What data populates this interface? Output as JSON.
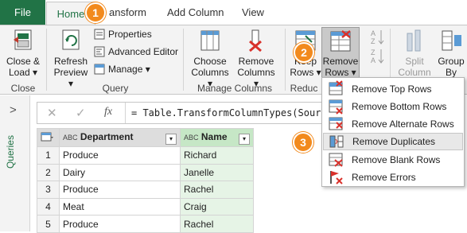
{
  "tabs": {
    "file": "File",
    "home": "Home",
    "transform": "ansform",
    "add_column": "Add Column",
    "view": "View"
  },
  "ribbon": {
    "close_load": [
      "Close &",
      "Load ▾"
    ],
    "close_group": "Close",
    "refresh_preview": [
      "Refresh",
      "Preview ▾"
    ],
    "properties": "Properties",
    "advanced_editor": "Advanced Editor",
    "manage": "Manage ▾",
    "query_group": "Query",
    "choose_columns": [
      "Choose",
      "Columns ▾"
    ],
    "remove_columns": [
      "Remove",
      "Columns ▾"
    ],
    "manage_columns_group": "Manage Columns",
    "keep_rows": [
      "Keep",
      "Rows ▾"
    ],
    "reduce_group": "Reduc",
    "remove_rows": [
      "Remove",
      "Rows ▾"
    ],
    "split_column": [
      "Split",
      "Column ▾"
    ],
    "group_by": [
      "Group",
      "By"
    ]
  },
  "left_pane": {
    "queries_label": "Queries",
    "collapse": ">"
  },
  "formula": {
    "cancel": "✕",
    "commit": "✓",
    "fx": "fx",
    "text": "= Table.TransformColumnTypes(Source,"
  },
  "table": {
    "columns": [
      {
        "type": "ABC",
        "name": "Department"
      },
      {
        "type": "ABC",
        "name": "Name"
      }
    ],
    "rows": [
      {
        "idx": "1",
        "department": "Produce",
        "name": "Richard"
      },
      {
        "idx": "2",
        "department": "Dairy",
        "name": "Janelle"
      },
      {
        "idx": "3",
        "department": "Produce",
        "name": "Rachel"
      },
      {
        "idx": "4",
        "department": "Meat",
        "name": "Craig"
      },
      {
        "idx": "5",
        "department": "Produce",
        "name": "Rachel"
      }
    ]
  },
  "menu": {
    "items": [
      "Remove Top Rows",
      "Remove Bottom Rows",
      "Remove Alternate Rows",
      "Remove Duplicates",
      "Remove Blank Rows",
      "Remove Errors"
    ]
  },
  "callouts": [
    "1",
    "2",
    "3"
  ],
  "colors": {
    "accent": "#217346",
    "callout": "#f28a1d",
    "selected_column": "#c6e7c6"
  }
}
